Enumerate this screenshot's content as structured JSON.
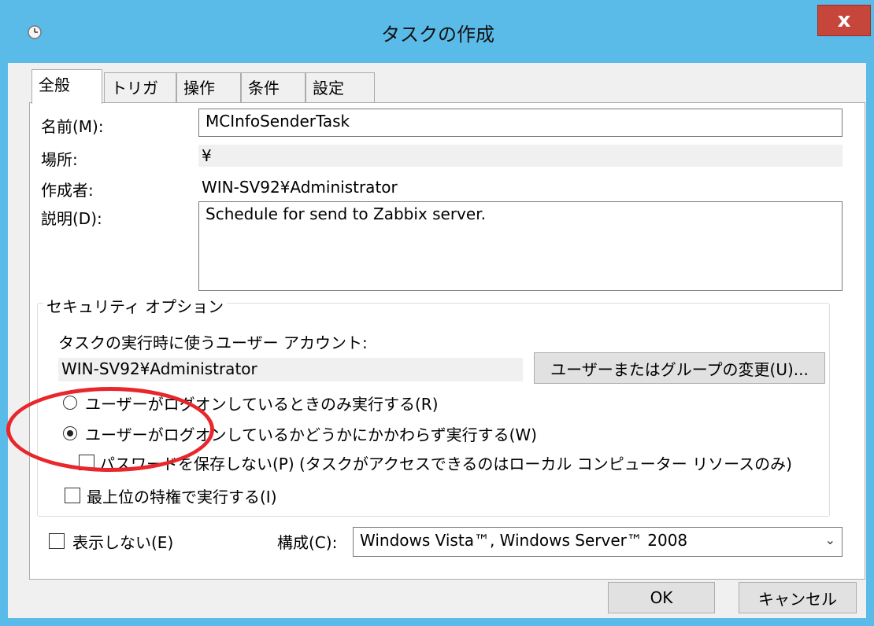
{
  "window": {
    "title": "タスクの作成",
    "close_label": "x"
  },
  "tabs": [
    {
      "label": "全般"
    },
    {
      "label": "トリガー"
    },
    {
      "label": "操作"
    },
    {
      "label": "条件"
    },
    {
      "label": "設定"
    }
  ],
  "general": {
    "name_label": "名前(M):",
    "name_value": "MCInfoSenderTask",
    "location_label": "場所:",
    "location_value": "¥",
    "author_label": "作成者:",
    "author_value": "WIN-SV92¥Administrator",
    "description_label": "説明(D):",
    "description_value": "Schedule for send to Zabbix server."
  },
  "security": {
    "group_title": "セキュリティ オプション",
    "account_prompt": "タスクの実行時に使うユーザー アカウント:",
    "account_value": "WIN-SV92¥Administrator",
    "change_user_button": "ユーザーまたはグループの変更(U)...",
    "radio_logged_on_only": "ユーザーがログオンしているときのみ実行する(R)",
    "radio_whether_logged_on": "ユーザーがログオンしているかどうかにかかわらず実行する(W)",
    "radio_selected": "whether_logged_on",
    "dont_store_password": "パスワードを保存しない(P) (タスクがアクセスできるのはローカル コンピューター リソースのみ)",
    "dont_store_password_checked": false,
    "highest_privileges": "最上位の特権で実行する(I)",
    "highest_privileges_checked": false
  },
  "footer": {
    "hidden_label": "表示しない(E)",
    "hidden_checked": false,
    "configure_label": "構成(C):",
    "configure_value": "Windows Vista™, Windows Server™ 2008",
    "ok_label": "OK",
    "cancel_label": "キャンセル"
  },
  "colors": {
    "titlebar": "#5bbbe8",
    "close_button": "#c7463b",
    "annotation_circle": "#e8262c"
  },
  "icons": {
    "title_icon": "clock-icon",
    "dropdown_arrow": "chevron-down-icon"
  }
}
